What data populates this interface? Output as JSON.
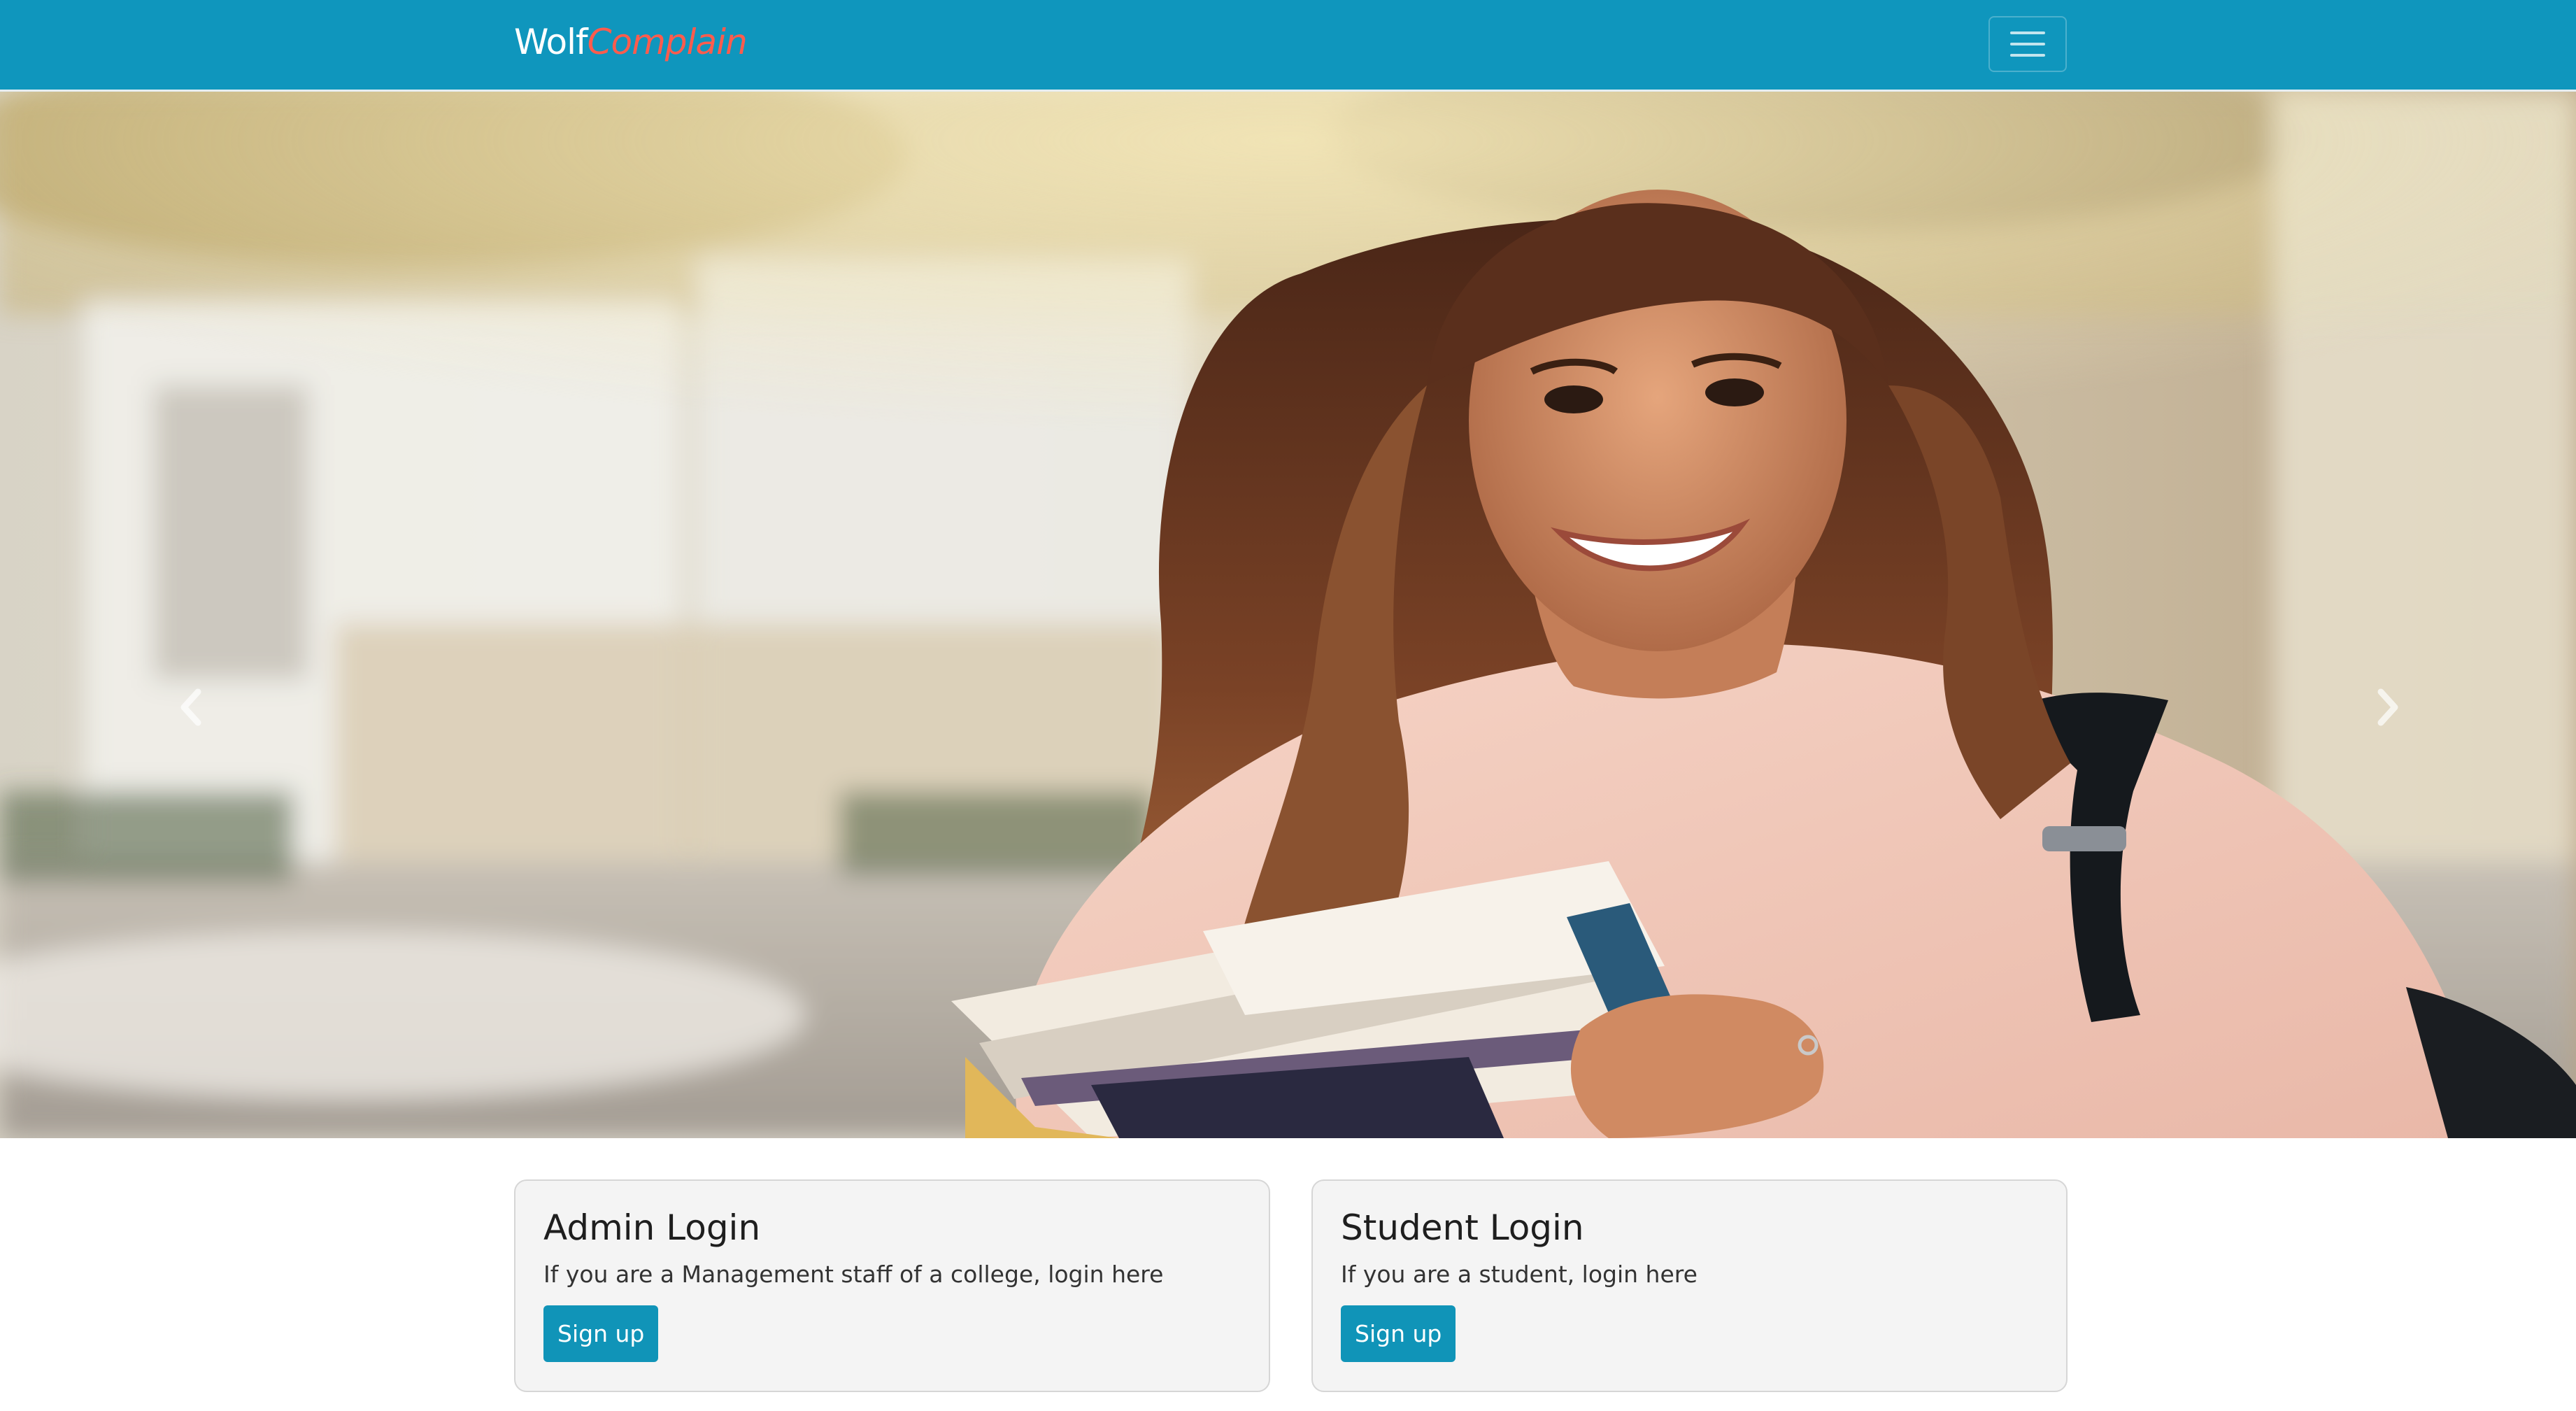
{
  "navbar": {
    "brand_part1": "Wolf",
    "brand_part2": "Complain",
    "toggler_icon": "hamburger-menu-icon",
    "background": "#0f96bd",
    "brand_accent": "#ff5c4d"
  },
  "carousel": {
    "prev_icon": "chevron-left-icon",
    "next_icon": "chevron-right-icon",
    "slides_count": 3,
    "active_slide": 2,
    "slide_alt": "Smiling student holding books with a backpack"
  },
  "cards": {
    "admin": {
      "title": "Admin Login",
      "text": "If you are a Management staff of a college, login here",
      "button": "Sign up"
    },
    "student": {
      "title": "Student Login",
      "text": "If you are a student, login here",
      "button": "Sign up"
    },
    "button_color": "#1094b8"
  }
}
